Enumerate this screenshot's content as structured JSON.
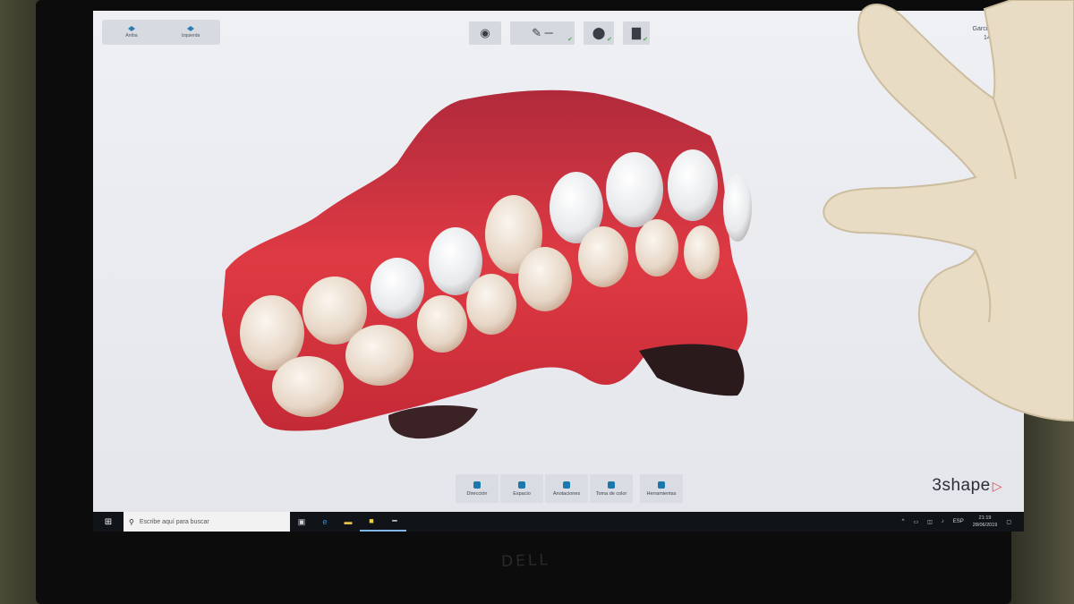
{
  "view_panel": {
    "btn_1": "Arriba",
    "btn_2": "Izquierda"
  },
  "workflow": {
    "step_1_icon": "scan-head-icon",
    "step_2_icon": "prep-icon",
    "step_3_icon": "tooth-icon",
    "step_4_icon": "folder-icon"
  },
  "patient": {
    "name": "Garcia Romero",
    "dob": "14/10/1987"
  },
  "toolbar": {
    "tools": [
      {
        "label": "Dirección",
        "icon": "direction-icon"
      },
      {
        "label": "Espacio",
        "icon": "space-icon"
      },
      {
        "label": "Anotaciones",
        "icon": "comment-icon"
      },
      {
        "label": "Toma de color",
        "icon": "color-camera-icon"
      },
      {
        "label": "Herramientas",
        "icon": "tools-icon"
      }
    ]
  },
  "brand": {
    "name": "3shape"
  },
  "taskbar": {
    "search_placeholder": "Escribe aquí para buscar",
    "lang": "ESP",
    "time": "21:19",
    "date": "28/06/2019"
  },
  "bezel_logo": "DELL",
  "colors": {
    "accent": "#1c78ad",
    "gum": "#d8323b",
    "brand_triangle": "#e0474c"
  }
}
